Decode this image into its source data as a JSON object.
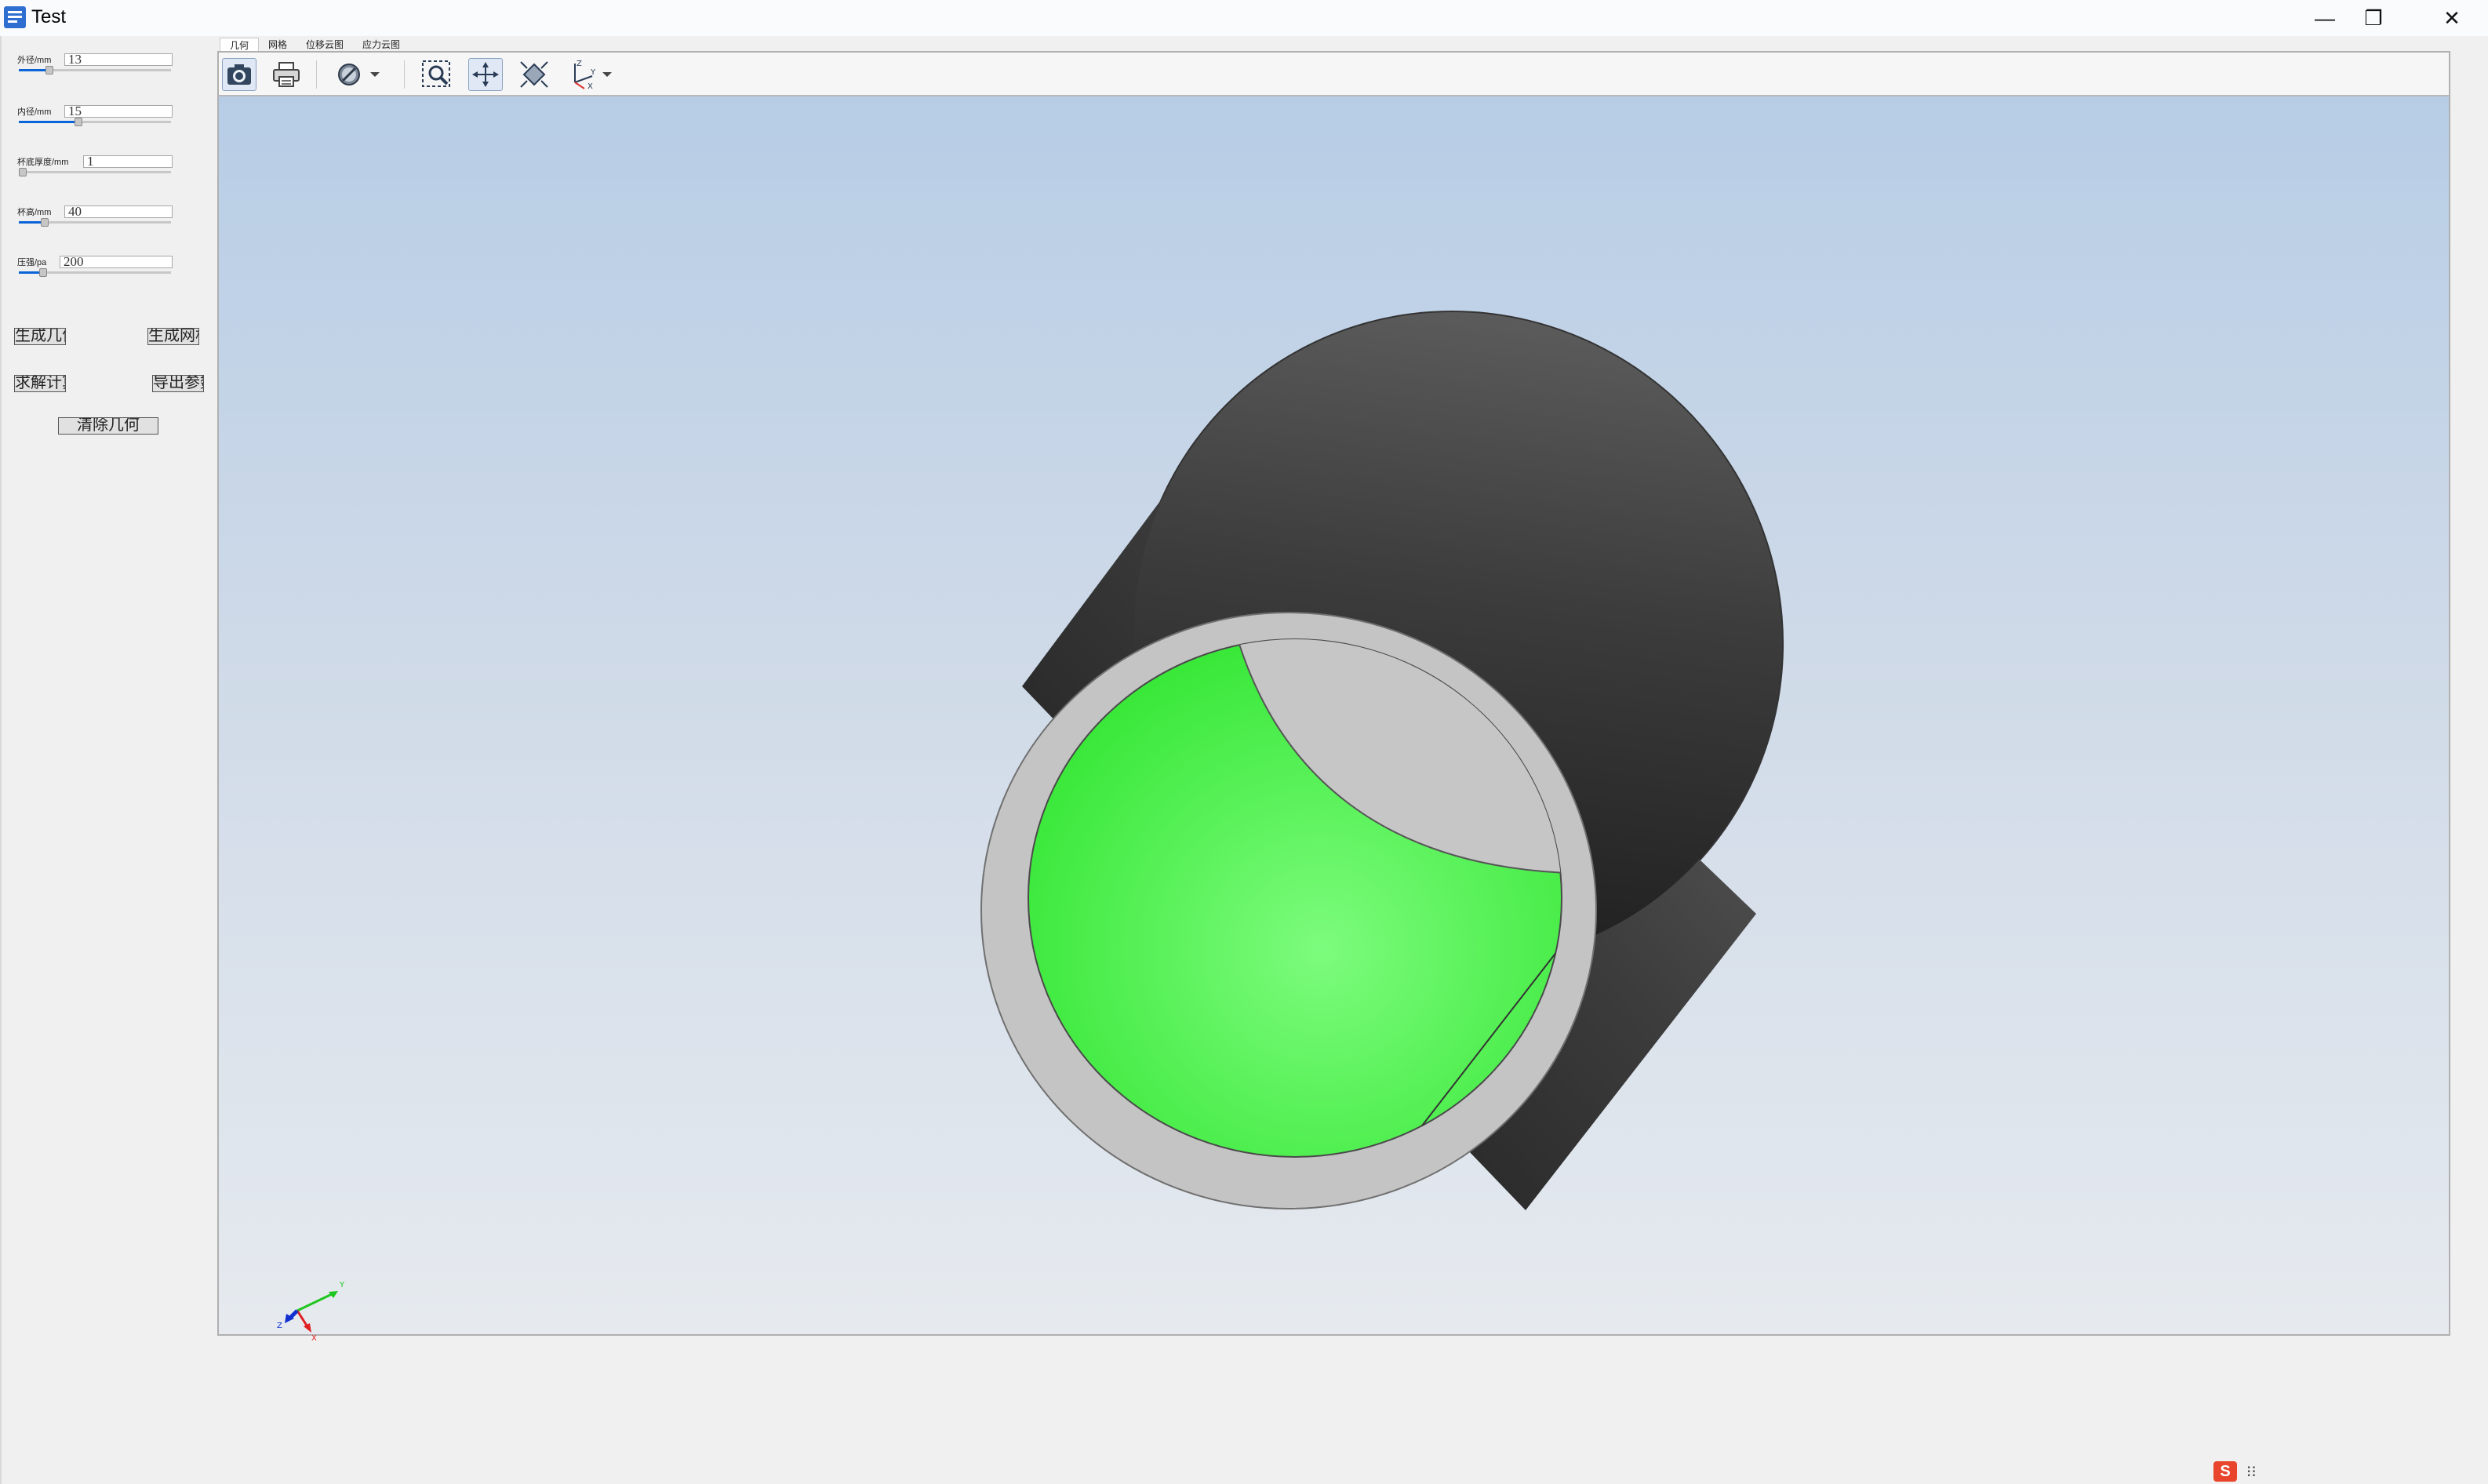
{
  "window": {
    "title": "Test",
    "minimize_glyph": "—",
    "restore_glyph": "❐",
    "close_glyph": "✕"
  },
  "params": [
    {
      "label": "外径/mm",
      "value": "13",
      "fill": 0.2
    },
    {
      "label": "内径/mm",
      "value": "15",
      "fill": 0.39
    },
    {
      "label": "杯底厚度/mm",
      "value": "1",
      "fill": 0.01
    },
    {
      "label": "杯高/mm",
      "value": "40",
      "fill": 0.17
    },
    {
      "label": "压强/pa",
      "value": "200",
      "fill": 0.16
    }
  ],
  "buttons": {
    "gen_geometry": "生成几何",
    "gen_mesh": "生成网格",
    "calculate": "求解计算",
    "export_params": "导出参数",
    "clear_geometry": "清除几何"
  },
  "tabs": [
    "几何",
    "网格",
    "位移云图",
    "应力云图"
  ],
  "toolbar": {
    "icons": [
      "camera-icon",
      "printer-icon",
      "display-mode-icon",
      "zoom-window-icon",
      "pan-icon",
      "fit-all-icon",
      "view-axes-icon"
    ]
  },
  "scene": {
    "outer_color": "#3a3a3a",
    "ring_color": "#c0c0c0",
    "inner_color": "#55f055",
    "axis_x": "X",
    "axis_y": "Y",
    "axis_z": "Z"
  },
  "tray": {
    "ime_label": "S",
    "extra": "⁝⁝"
  }
}
